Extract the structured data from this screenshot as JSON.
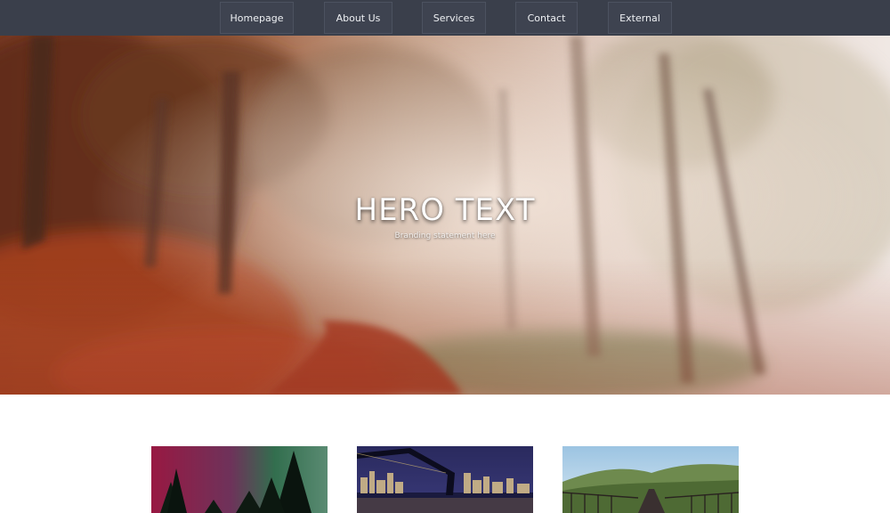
{
  "nav": {
    "items": [
      {
        "label": "Homepage"
      },
      {
        "label": "About Us"
      },
      {
        "label": "Services"
      },
      {
        "label": "Contact"
      },
      {
        "label": "External"
      }
    ]
  },
  "hero": {
    "title": "HERO TEXT",
    "subtitle": "Branding statement here"
  },
  "cards": [
    {
      "image": "aurora-forest-photo"
    },
    {
      "image": "city-bridge-night-photo"
    },
    {
      "image": "railway-bridge-hills-photo"
    }
  ],
  "colors": {
    "nav_background": "#3a3f4b",
    "nav_text": "#eef0f3",
    "page_background": "#ffffff"
  }
}
